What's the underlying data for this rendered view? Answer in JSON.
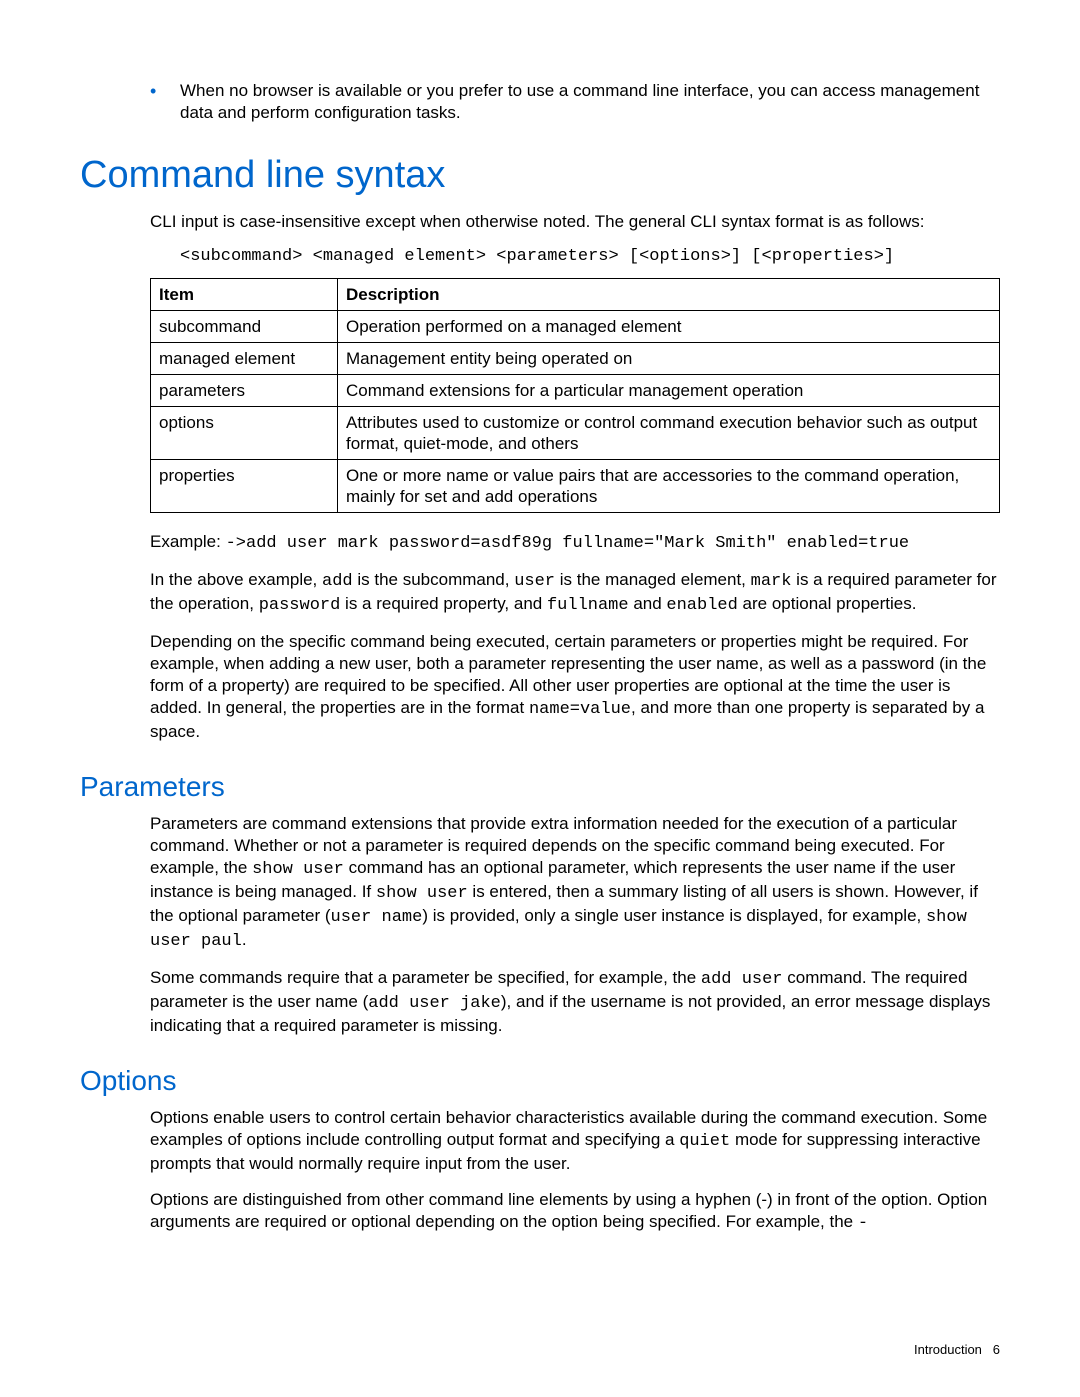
{
  "bullet": "When no browser is available or you prefer to use a command line interface, you can access management data and perform configuration tasks.",
  "h1": "Command line syntax",
  "intro_sentence": "CLI input is case-insensitive except when otherwise noted. The general CLI syntax format is as follows:",
  "syntax_template": "<subcommand> <managed element> <parameters> [<options>] [<properties>]",
  "table": {
    "headers": {
      "item": "Item",
      "description": "Description"
    },
    "rows": [
      {
        "item": "subcommand",
        "desc": "Operation performed on a managed element"
      },
      {
        "item": "managed element",
        "desc": "Management entity being operated on"
      },
      {
        "item": "parameters",
        "desc": "Command extensions for a particular management operation"
      },
      {
        "item": "options",
        "desc": "Attributes used to customize or control command execution behavior such as output format, quiet-mode, and others"
      },
      {
        "item": "properties",
        "desc": "One or more name or value pairs that are accessories to the command operation, mainly for set and add operations"
      }
    ]
  },
  "example": {
    "label": "Example: ",
    "code": "->add user mark password=asdf89g fullname=\"Mark Smith\" enabled=true"
  },
  "example_explain": {
    "t1": "In the above example, ",
    "c1": "add",
    "t2": " is the subcommand, ",
    "c2": "user",
    "t3": " is the managed element, ",
    "c3": "mark",
    "t4": " is a required parameter for the operation, ",
    "c4": "password",
    "t5": " is a required property, and ",
    "c5": "fullname",
    "t6": " and ",
    "c6": "enabled",
    "t7": " are optional properties."
  },
  "depending": {
    "t1": "Depending on the specific command being executed, certain parameters or properties might be required. For example, when adding a new user, both a parameter representing the user name, as well as a password (in the form of a property) are required to be specified. All other user properties are optional at the time the user is added. In general, the properties are in the format ",
    "c1": "name=value",
    "t2": ", and more than one property is separated by a space."
  },
  "params_h2": "Parameters",
  "params_p1": {
    "t1": "Parameters are command extensions that provide extra information needed for the execution of a particular command. Whether or not a parameter is required depends on the specific command being executed. For example, the ",
    "c1": "show user",
    "t2": " command has an optional parameter, which represents the user name if the user instance is being managed. If ",
    "c2": "show user",
    "t3": " is entered, then a summary listing of all users is shown. However, if the optional parameter (",
    "c3": "user name",
    "t4": ") is provided, only a single user instance is displayed, for example, ",
    "c4": "show user paul",
    "t5": "."
  },
  "params_p2": {
    "t1": "Some commands require that a parameter be specified, for example, the ",
    "c1": "add user",
    "t2": " command. The required parameter is the user name (",
    "c2": "add user jake",
    "t3": "), and if the username is not provided, an error message displays indicating that a required parameter is missing."
  },
  "options_h2": "Options",
  "options_p1": {
    "t1": "Options enable users to control certain behavior characteristics available during the command execution. Some examples of options include controlling output format and specifying a ",
    "c1": "quiet",
    "t2": " mode for suppressing interactive prompts that would normally require input from the user."
  },
  "options_p2": {
    "t1": "Options are distinguished from other command line elements by using a hyphen (-) in front of the option. Option arguments are required or optional depending on the option being specified. For example, the ",
    "c1": "-"
  },
  "footer": {
    "section": "Introduction",
    "pagenum": "6"
  }
}
